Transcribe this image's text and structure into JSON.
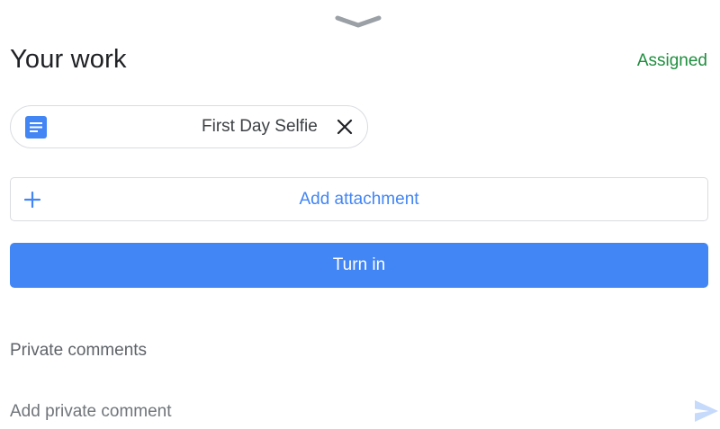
{
  "header": {
    "title": "Your work",
    "status": "Assigned",
    "handle_icon": "chevron-down-icon"
  },
  "attachment": {
    "file_name": "First Day Selfie",
    "file_icon": "google-docs-icon",
    "remove_icon": "close-icon"
  },
  "actions": {
    "add_attachment_label": "Add attachment",
    "add_icon": "plus-icon",
    "turn_in_label": "Turn in"
  },
  "comments": {
    "heading": "Private comments",
    "placeholder": "Add private comment",
    "send_icon": "send-icon"
  },
  "colors": {
    "accent": "#4285f4",
    "status_green": "#1e8e3e",
    "border": "#dadce0",
    "send_disabled": "#c6dafc"
  }
}
